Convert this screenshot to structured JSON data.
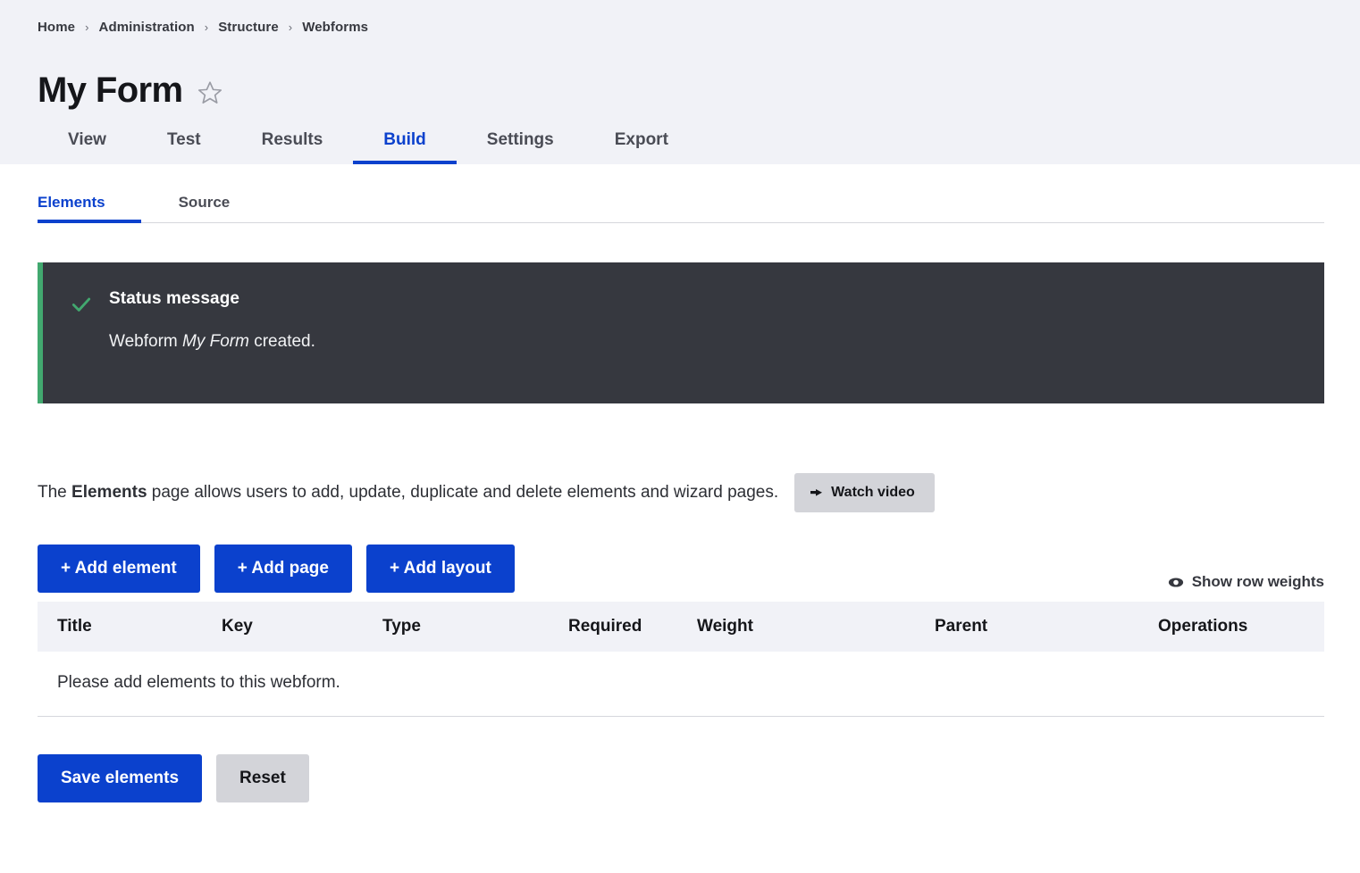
{
  "breadcrumb": {
    "separator": "›",
    "items": [
      {
        "label": "Home"
      },
      {
        "label": "Administration"
      },
      {
        "label": "Structure"
      },
      {
        "label": "Webforms"
      }
    ]
  },
  "header": {
    "title": "My Form",
    "star_icon": "star-outline-icon"
  },
  "primary_tabs": [
    {
      "label": "View",
      "active": false
    },
    {
      "label": "Test",
      "active": false
    },
    {
      "label": "Results",
      "active": false
    },
    {
      "label": "Build",
      "active": true
    },
    {
      "label": "Settings",
      "active": false
    },
    {
      "label": "Export",
      "active": false
    }
  ],
  "sub_tabs": [
    {
      "label": "Elements",
      "active": true
    },
    {
      "label": "Source",
      "active": false
    }
  ],
  "status_message": {
    "icon": "check-icon",
    "title": "Status message",
    "body_prefix": "Webform ",
    "body_emphasis": "My Form",
    "body_suffix": " created.",
    "accent_color": "#42a86f",
    "background_color": "#36383f"
  },
  "description": {
    "prefix": "The ",
    "bold": "Elements",
    "suffix": " page allows users to add, update, duplicate and delete elements and wizard pages.",
    "watch_video_label": "Watch video",
    "watch_video_icon": "play-icon"
  },
  "action_buttons": [
    {
      "label": "+ Add element",
      "name": "add-element-button"
    },
    {
      "label": "+ Add page",
      "name": "add-page-button"
    },
    {
      "label": "+ Add layout",
      "name": "add-layout-button"
    }
  ],
  "row_weights": {
    "label": "Show row weights",
    "icon": "eye-icon"
  },
  "table": {
    "columns": [
      "Title",
      "Key",
      "Type",
      "Required",
      "Weight",
      "Parent",
      "Operations"
    ],
    "empty_message": "Please add elements to this webform."
  },
  "form_actions": {
    "save_label": "Save elements",
    "reset_label": "Reset"
  },
  "colors": {
    "accent_blue": "#0b41cd",
    "header_band": "#f1f2f7",
    "status_dark": "#36383f",
    "status_green": "#42a86f",
    "button_grey": "#d3d4d9"
  }
}
